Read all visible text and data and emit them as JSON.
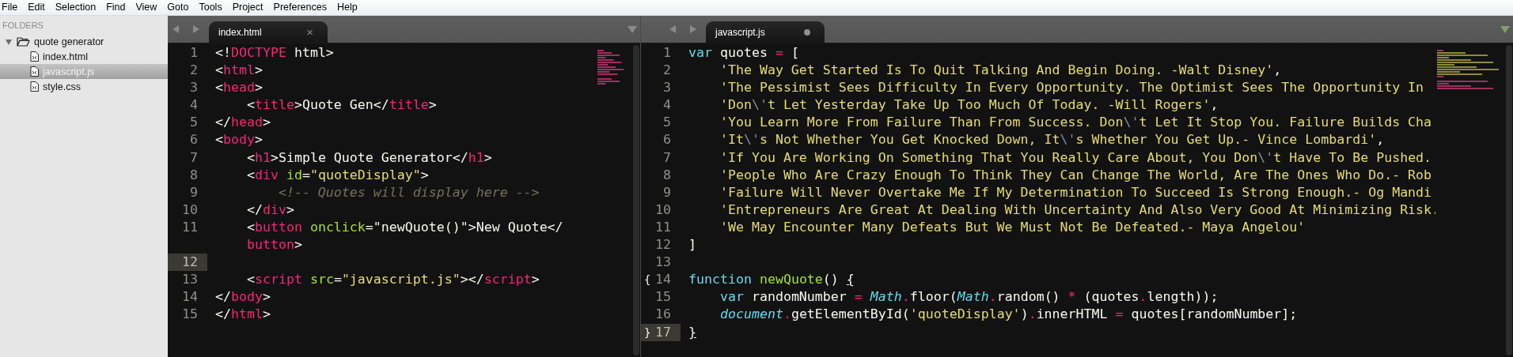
{
  "menu": [
    "File",
    "Edit",
    "Selection",
    "Find",
    "View",
    "Goto",
    "Tools",
    "Project",
    "Preferences",
    "Help"
  ],
  "sidebar": {
    "header": "FOLDERS",
    "items": [
      {
        "label": "quote generator",
        "expanded": true,
        "selected": false,
        "children": [
          {
            "label": "index.html",
            "selected": false
          },
          {
            "label": "javascript.js",
            "selected": true
          },
          {
            "label": "style.css",
            "selected": false
          }
        ]
      }
    ]
  },
  "panes": [
    {
      "tab": {
        "label": "index.html",
        "close_glyph": "×",
        "modified": false,
        "selected": true
      },
      "lines": [
        {
          "number": "1",
          "current": false,
          "tokens": [
            {
              "kind": "plain",
              "text": "<!"
            },
            {
              "kind": "tag",
              "text": "DOCTYPE"
            },
            {
              "kind": "plain",
              "text": " html>"
            }
          ]
        },
        {
          "number": "2",
          "current": false,
          "tokens": [
            {
              "kind": "plain",
              "text": "<"
            },
            {
              "kind": "tag",
              "text": "html"
            },
            {
              "kind": "plain",
              "text": ">"
            }
          ]
        },
        {
          "number": "3",
          "current": false,
          "tokens": [
            {
              "kind": "plain",
              "text": "<"
            },
            {
              "kind": "tag",
              "text": "head"
            },
            {
              "kind": "plain",
              "text": ">"
            }
          ]
        },
        {
          "number": "4",
          "current": false,
          "tokens": [
            {
              "kind": "plain",
              "text": "    <"
            },
            {
              "kind": "tag",
              "text": "title"
            },
            {
              "kind": "plain",
              "text": ">Quote Gen</"
            },
            {
              "kind": "tag",
              "text": "title"
            },
            {
              "kind": "plain",
              "text": ">"
            }
          ]
        },
        {
          "number": "5",
          "current": false,
          "tokens": [
            {
              "kind": "plain",
              "text": "</"
            },
            {
              "kind": "tag",
              "text": "head"
            },
            {
              "kind": "plain",
              "text": ">"
            }
          ]
        },
        {
          "number": "6",
          "current": false,
          "tokens": [
            {
              "kind": "plain",
              "text": "<"
            },
            {
              "kind": "tag",
              "text": "body"
            },
            {
              "kind": "plain",
              "text": ">"
            }
          ]
        },
        {
          "number": "7",
          "current": false,
          "tokens": [
            {
              "kind": "plain",
              "text": "    <"
            },
            {
              "kind": "tag",
              "text": "h1"
            },
            {
              "kind": "plain",
              "text": ">Simple Quote Generator</"
            },
            {
              "kind": "tag",
              "text": "h1"
            },
            {
              "kind": "plain",
              "text": ">"
            }
          ]
        },
        {
          "number": "8",
          "current": false,
          "tokens": [
            {
              "kind": "plain",
              "text": "    <"
            },
            {
              "kind": "tag",
              "text": "div"
            },
            {
              "kind": "attr",
              "text": " id"
            },
            {
              "kind": "plain",
              "text": "="
            },
            {
              "kind": "string",
              "text": "\"quoteDisplay\""
            },
            {
              "kind": "plain",
              "text": ">"
            }
          ]
        },
        {
          "number": "9",
          "current": false,
          "tokens": [
            {
              "kind": "comment",
              "text": "        <!-- Quotes will display here -->"
            }
          ]
        },
        {
          "number": "10",
          "current": false,
          "tokens": [
            {
              "kind": "plain",
              "text": "    </"
            },
            {
              "kind": "tag",
              "text": "div"
            },
            {
              "kind": "plain",
              "text": ">"
            }
          ]
        },
        {
          "number": "11",
          "current": false,
          "tokens": [
            {
              "kind": "plain",
              "text": "    <"
            },
            {
              "kind": "tag",
              "text": "button"
            },
            {
              "kind": "attr",
              "text": " onclick"
            },
            {
              "kind": "plain",
              "text": "=\"newQuote()\">New Quote</"
            }
          ],
          "wrap_tokens": [
            {
              "kind": "tag",
              "text": "    button"
            },
            {
              "kind": "plain",
              "text": ">"
            }
          ]
        },
        {
          "number": "12",
          "current": true
        },
        {
          "number": "13",
          "current": false,
          "tokens": [
            {
              "kind": "plain",
              "text": "    <"
            },
            {
              "kind": "tag",
              "text": "script"
            },
            {
              "kind": "attr",
              "text": " src"
            },
            {
              "kind": "plain",
              "text": "="
            },
            {
              "kind": "string",
              "text": "\"javascript.js\""
            },
            {
              "kind": "plain",
              "text": "></"
            },
            {
              "kind": "tag",
              "text": "script"
            },
            {
              "kind": "plain",
              "text": ">"
            }
          ]
        },
        {
          "number": "14",
          "current": false,
          "tokens": [
            {
              "kind": "plain",
              "text": "</"
            },
            {
              "kind": "tag",
              "text": "body"
            },
            {
              "kind": "plain",
              "text": ">"
            }
          ]
        },
        {
          "number": "15",
          "current": false,
          "tokens": [
            {
              "kind": "plain",
              "text": "</"
            },
            {
              "kind": "tag",
              "text": "html"
            },
            {
              "kind": "plain",
              "text": ">"
            }
          ]
        }
      ]
    },
    {
      "tab": {
        "label": "javascript.js",
        "modified": true,
        "selected": true
      },
      "lines": [
        {
          "number": "1",
          "current": false,
          "tokens": [
            {
              "kind": "keyword",
              "text": "var"
            },
            {
              "kind": "plain",
              "text": " quotes "
            },
            {
              "kind": "operator",
              "text": "="
            },
            {
              "kind": "plain",
              "text": " ["
            }
          ]
        },
        {
          "number": "2",
          "current": false,
          "tokens": [
            {
              "kind": "string",
              "text": "    'The Way Get Started Is To Quit Talking And Begin Doing. -Walt Disney'"
            },
            {
              "kind": "plain",
              "text": ","
            }
          ]
        },
        {
          "number": "3",
          "current": false,
          "tokens": [
            {
              "kind": "string",
              "text": "    'The Pessimist Sees Difficulty In Every Opportunity. The Optimist Sees The Opportunity In"
            }
          ]
        },
        {
          "number": "4",
          "current": false,
          "tokens": [
            {
              "kind": "string",
              "text": "    'Don"
            },
            {
              "kind": "escape",
              "text": "\\'"
            },
            {
              "kind": "string",
              "text": "t Let Yesterday Take Up Too Much Of Today. -Will Rogers'"
            },
            {
              "kind": "plain",
              "text": ","
            }
          ]
        },
        {
          "number": "5",
          "current": false,
          "tokens": [
            {
              "kind": "string",
              "text": "    'You Learn More From Failure Than From Success. Don"
            },
            {
              "kind": "escape",
              "text": "\\'"
            },
            {
              "kind": "string",
              "text": "t Let It Stop You. Failure Builds Cha"
            }
          ]
        },
        {
          "number": "6",
          "current": false,
          "tokens": [
            {
              "kind": "string",
              "text": "    'It"
            },
            {
              "kind": "escape",
              "text": "\\'"
            },
            {
              "kind": "string",
              "text": "s Not Whether You Get Knocked Down, It"
            },
            {
              "kind": "escape",
              "text": "\\'"
            },
            {
              "kind": "string",
              "text": "s Whether You Get Up.- Vince Lombardi'"
            },
            {
              "kind": "plain",
              "text": ","
            }
          ]
        },
        {
          "number": "7",
          "current": false,
          "tokens": [
            {
              "kind": "string",
              "text": "    'If You Are Working On Something That You Really Care About, You Don"
            },
            {
              "kind": "escape",
              "text": "\\'"
            },
            {
              "kind": "string",
              "text": "t Have To Be Pushed."
            }
          ]
        },
        {
          "number": "8",
          "current": false,
          "tokens": [
            {
              "kind": "string",
              "text": "    'People Who Are Crazy Enough To Think They Can Change The World, Are The Ones Who Do.- Rob"
            }
          ]
        },
        {
          "number": "9",
          "current": false,
          "tokens": [
            {
              "kind": "string",
              "text": "    'Failure Will Never Overtake Me If My Determination To Succeed Is Strong Enough.- Og Mandi"
            }
          ]
        },
        {
          "number": "10",
          "current": false,
          "tokens": [
            {
              "kind": "string",
              "text": "    'Entrepreneurs Are Great At Dealing With Uncertainty And Also Very Good At Minimizing Risk."
            }
          ]
        },
        {
          "number": "11",
          "current": false,
          "tokens": [
            {
              "kind": "string",
              "text": "    'We May Encounter Many Defeats But We Must Not Be Defeated.- Maya Angelou'"
            }
          ]
        },
        {
          "number": "12",
          "current": false,
          "tokens": [
            {
              "kind": "plain",
              "text": "]"
            }
          ]
        },
        {
          "number": "13",
          "current": false
        },
        {
          "number": "14",
          "current": false,
          "gutter_mark": "{",
          "tokens": [
            {
              "kind": "keyword",
              "text": "function"
            },
            {
              "kind": "function",
              "text": " newQuote"
            },
            {
              "kind": "plain",
              "text": "() "
            },
            {
              "kind": "bracket",
              "text": "{"
            }
          ]
        },
        {
          "number": "15",
          "current": false,
          "tokens": [
            {
              "kind": "keyword",
              "text": "    var"
            },
            {
              "kind": "plain",
              "text": " randomNumber "
            },
            {
              "kind": "operator",
              "text": "="
            },
            {
              "kind": "support",
              "text": " Math"
            },
            {
              "kind": "operator",
              "text": "."
            },
            {
              "kind": "plain",
              "text": "floor("
            },
            {
              "kind": "support",
              "text": "Math"
            },
            {
              "kind": "operator",
              "text": "."
            },
            {
              "kind": "plain",
              "text": "random() "
            },
            {
              "kind": "operator",
              "text": "*"
            },
            {
              "kind": "plain",
              "text": " (quotes"
            },
            {
              "kind": "operator",
              "text": "."
            },
            {
              "kind": "plain",
              "text": "length));"
            }
          ]
        },
        {
          "number": "16",
          "current": false,
          "tokens": [
            {
              "kind": "support",
              "text": "    document"
            },
            {
              "kind": "operator",
              "text": "."
            },
            {
              "kind": "plain",
              "text": "getElementById("
            },
            {
              "kind": "string",
              "text": "'quoteDisplay'"
            },
            {
              "kind": "plain",
              "text": ")"
            },
            {
              "kind": "operator",
              "text": "."
            },
            {
              "kind": "plain",
              "text": "innerHTML "
            },
            {
              "kind": "operator",
              "text": "="
            },
            {
              "kind": "plain",
              "text": " quotes[randomNumber];"
            }
          ]
        },
        {
          "number": "17",
          "current": true,
          "gutter_mark": "}",
          "tokens": [
            {
              "kind": "bracket",
              "text": "}"
            }
          ]
        }
      ]
    }
  ]
}
